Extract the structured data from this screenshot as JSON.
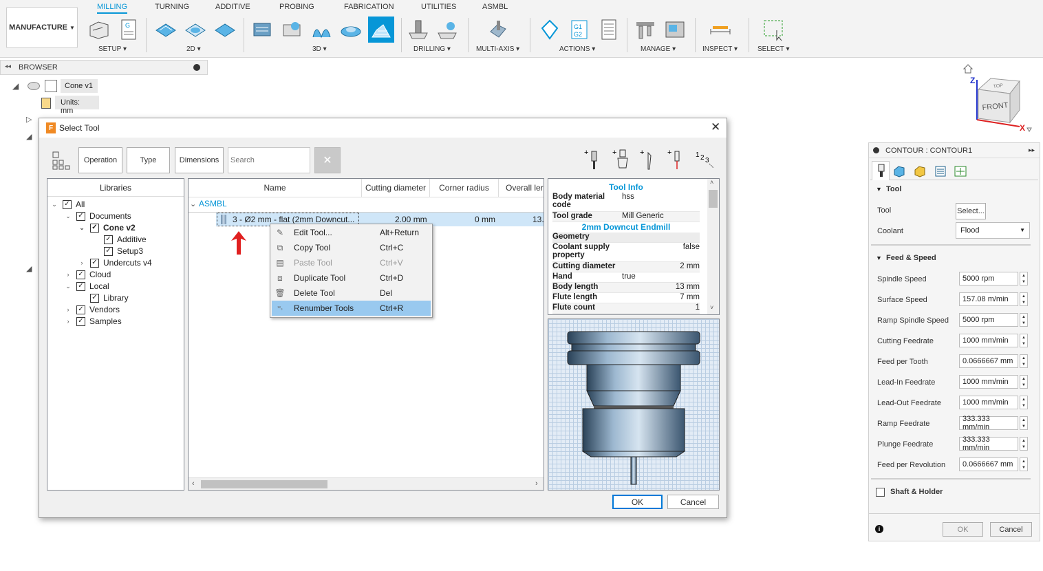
{
  "toolbar": {
    "manufacture_label": "MANUFACTURE",
    "tabs": [
      "MILLING",
      "TURNING",
      "ADDITIVE",
      "PROBING",
      "FABRICATION",
      "UTILITIES",
      "ASMBL"
    ],
    "groups": [
      "SETUP",
      "2D",
      "3D",
      "DRILLING",
      "MULTI-AXIS",
      "ACTIONS",
      "MANAGE",
      "INSPECT",
      "SELECT"
    ]
  },
  "browser": {
    "title": "BROWSER",
    "root": "Cone v1",
    "units": "Units: mm"
  },
  "dialog": {
    "title": "Select Tool",
    "filters": [
      "Operation",
      "Type",
      "Dimensions"
    ],
    "search_placeholder": "Search",
    "libraries_header": "Libraries",
    "tree": [
      {
        "label": "All",
        "bold": false
      },
      {
        "label": "Documents",
        "bold": false
      },
      {
        "label": "Cone v2",
        "bold": true
      },
      {
        "label": "Additive",
        "bold": false
      },
      {
        "label": "Setup3",
        "bold": false
      },
      {
        "label": "Undercuts v4",
        "bold": false
      },
      {
        "label": "Cloud",
        "bold": false
      },
      {
        "label": "Local",
        "bold": false
      },
      {
        "label": "Library",
        "bold": false
      },
      {
        "label": "Vendors",
        "bold": false
      },
      {
        "label": "Samples",
        "bold": false
      }
    ],
    "columns": [
      "Name",
      "Cutting diameter",
      "Corner radius",
      "Overall ler"
    ],
    "group_label": "ASMBL",
    "row": {
      "name": "3 - Ø2 mm - flat (2mm Downcut...",
      "cutting_diameter": "2.00 mm",
      "corner_radius": "0 mm",
      "overall": "13."
    },
    "context_menu": [
      {
        "label": "Edit Tool...",
        "shortcut": "Alt+Return",
        "icon": "pencil-icon",
        "disabled": false,
        "selected": false
      },
      {
        "label": "Copy Tool",
        "shortcut": "Ctrl+C",
        "icon": "copy-icon",
        "disabled": false,
        "selected": false
      },
      {
        "label": "Paste Tool",
        "shortcut": "Ctrl+V",
        "icon": "paste-icon",
        "disabled": true,
        "selected": false
      },
      {
        "label": "Duplicate Tool",
        "shortcut": "Ctrl+D",
        "icon": "duplicate-icon",
        "disabled": false,
        "selected": false
      },
      {
        "label": "Delete Tool",
        "shortcut": "Del",
        "icon": "trash-icon",
        "disabled": false,
        "selected": false
      },
      {
        "label": "Renumber Tools",
        "shortcut": "Ctrl+R",
        "icon": "renumber-icon",
        "disabled": false,
        "selected": true
      }
    ],
    "tool_info": {
      "header": "Tool Info",
      "subheader": "2mm Downcut Endmill",
      "section_geometry": "Geometry",
      "rows_top": [
        {
          "k": "Body material code",
          "v": "hss"
        },
        {
          "k": "Tool grade",
          "v": "Mill Generic"
        }
      ],
      "rows_geo": [
        {
          "k": "Coolant supply property",
          "v": "false"
        },
        {
          "k": "Cutting diameter",
          "v": "2 mm"
        },
        {
          "k": "Hand",
          "v": "true"
        },
        {
          "k": "Body length",
          "v": "13 mm"
        },
        {
          "k": "Flute length",
          "v": "7 mm"
        },
        {
          "k": "Flute count",
          "v": "1"
        }
      ]
    },
    "ok": "OK",
    "cancel": "Cancel"
  },
  "right_panel": {
    "title": "CONTOUR : CONTOUR1",
    "tool_section": "Tool",
    "tool_label": "Tool",
    "tool_button": "Select...",
    "coolant_label": "Coolant",
    "coolant_value": "Flood",
    "feed_section": "Feed & Speed",
    "fields": [
      {
        "label": "Spindle Speed",
        "value": "5000 rpm"
      },
      {
        "label": "Surface Speed",
        "value": "157.08 m/min"
      },
      {
        "label": "Ramp Spindle Speed",
        "value": "5000 rpm"
      },
      {
        "label": "Cutting Feedrate",
        "value": "1000 mm/min"
      },
      {
        "label": "Feed per Tooth",
        "value": "0.0666667 mm"
      },
      {
        "label": "Lead-In Feedrate",
        "value": "1000 mm/min"
      },
      {
        "label": "Lead-Out Feedrate",
        "value": "1000 mm/min"
      },
      {
        "label": "Ramp Feedrate",
        "value": "333.333 mm/min"
      },
      {
        "label": "Plunge Feedrate",
        "value": "333.333 mm/min"
      },
      {
        "label": "Feed per Revolution",
        "value": "0.0666667 mm"
      }
    ],
    "shaft_label": "Shaft & Holder",
    "ok": "OK",
    "cancel": "Cancel"
  },
  "viewcube": {
    "front": "FRONT",
    "top": "TOP",
    "z": "Z",
    "x": "X"
  },
  "colors": {
    "accent": "#0696d7",
    "selection": "#99c9ef",
    "arrow": "#e02020"
  }
}
